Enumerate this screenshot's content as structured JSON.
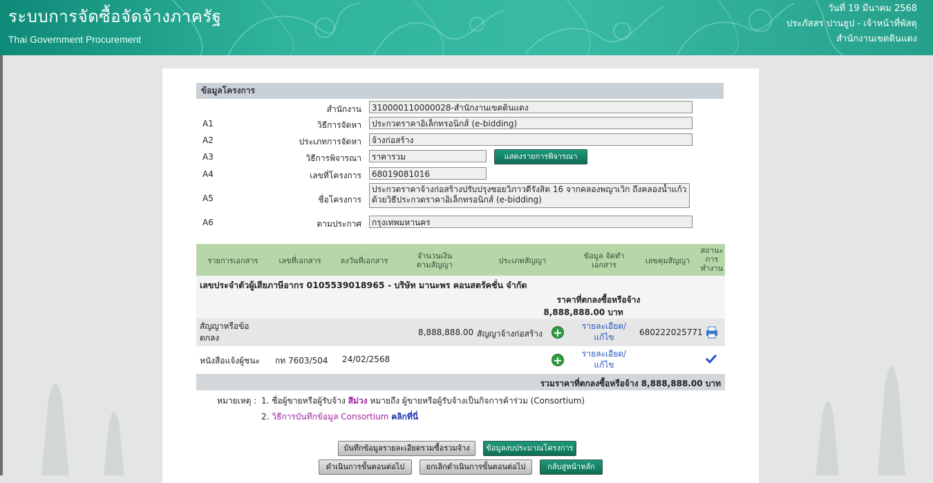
{
  "header": {
    "title": "ระบบการจัดซื้อจัดจ้างภาครัฐ",
    "subtitle": "Thai Government Procurement",
    "date": "วันที่ 19 มีนาคม 2568",
    "user": "ประภัสสร ปานธูป - เจ้าหน้าที่พัสดุ",
    "office": "สำนักงานเขตดินแดง"
  },
  "project": {
    "section_title": "ข้อมูลโครงการ",
    "fields": [
      {
        "code": "",
        "label": "สำนักงาน",
        "value": "310000110000028-สำนักงานเขตดินแดง"
      },
      {
        "code": "A1",
        "label": "วิธีการจัดหา",
        "value": "ประกวดราคาอิเล็กทรอนิกส์ (e-bidding)"
      },
      {
        "code": "A2",
        "label": "ประเภทการจัดหา",
        "value": "จ้างก่อสร้าง"
      },
      {
        "code": "A3",
        "label": "วิธีการพิจารณา",
        "value": "ราคารวม"
      },
      {
        "code": "A4",
        "label": "เลขที่โครงการ",
        "value": "68019081016"
      },
      {
        "code": "A5",
        "label": "ชื่อโครงการ",
        "value": "ประกวดราคาจ้างก่อสร้างปรับปรุงซอยวิภาวดีรังสิต 16 จากคลองพญาเวิก ถึงคลองน้ำแก้ว ด้วยวิธีประกวดราคาอิเล็กทรอนิกส์ (e-bidding)"
      },
      {
        "code": "A6",
        "label": "ตามประกาศ",
        "value": "กรุงเทพมหานคร"
      }
    ],
    "show_criteria_button": "แสดงรายการพิจารณา"
  },
  "table": {
    "headers": [
      "รายการเอกสาร",
      "เลขที่เอกสาร",
      "ลงวันที่เอกสาร",
      "จำนวนเงิน ตามสัญญา",
      "ประเภทสัญญา",
      "ข้อมูล จัดทำเอกสาร",
      "เลขคุมสัญญา",
      "สถานะ การ ทำงาน"
    ],
    "vendor_line": "เลขประจำตัวผู้เสียภาษีอากร 0105539018965 - บริษัท มานะพร คอนสตรัคชั่น จำกัด",
    "agreed_price_label": "ราคาที่ตกลงซื้อหรือจ้าง",
    "agreed_price_value": "8,888,888.00 บาท",
    "rows": [
      {
        "doc": "สัญญาหรือข้อตกลง",
        "doc_no": "",
        "doc_date": "",
        "amount": "8,888,888.00",
        "contract_type": "สัญญาจ้างก่อสร้าง",
        "detail_link": "รายละเอียด/แก้ไข",
        "control_no": "680222025771",
        "status_icon": "print-icon"
      },
      {
        "doc": "หนังสือแจ้งผู้ชนะ",
        "doc_no": "กท 7603/504",
        "doc_date": "24/02/2568",
        "amount": "",
        "contract_type": "",
        "detail_link": "รายละเอียด/แก้ไข",
        "control_no": "",
        "status_icon": "check-icon"
      }
    ],
    "total_line": "รวมราคาที่ตกลงซื้อหรือจ้าง 8,888,888.00 บาท"
  },
  "notes": {
    "label": "หมายเหตุ :",
    "note1_prefix": "1. ชื่อผู้ขายหรือผู้รับจ้าง",
    "note1_color_word": "สีม่วง",
    "note1_suffix": "หมายถึง ผู้ขายหรือผู้รับจ้างเป็นกิจการค้าร่วม (Consortium)",
    "note2_prefix": "2.",
    "note2_text": "วิธีการบันทึกข้อมูล Consortium",
    "note2_link": "คลิกที่นี่"
  },
  "actions": {
    "save_joint": "บันทึกข้อมูลรายละเอียดรวมซื้อรวมจ้าง",
    "budget": "ข้อมูลงบประมาณโครงการ",
    "next_step": "ดำเนินการขั้นตอนต่อไป",
    "cancel_next": "ยกเลิกดำเนินการขั้นตอนต่อไป",
    "home": "กลับสู่หน้าหลัก"
  },
  "colors": {
    "header_teal": "#2fb39b",
    "table_head": "#b7d7a8",
    "purple": "#a020a0",
    "link_blue": "#2a55c0"
  }
}
